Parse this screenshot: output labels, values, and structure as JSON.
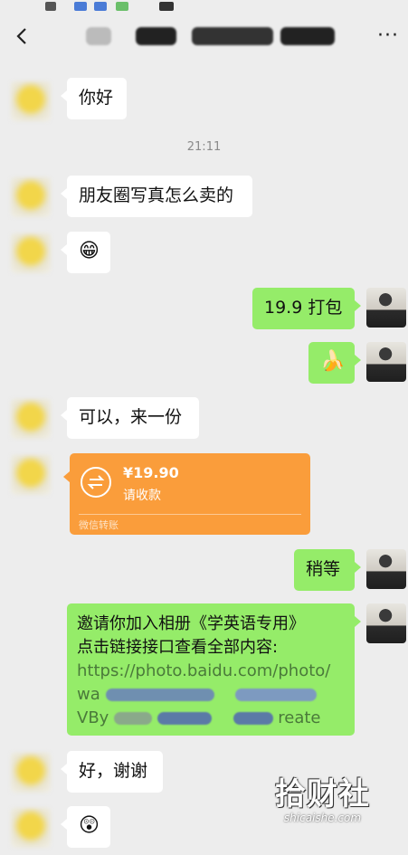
{
  "navbar": {
    "more_label": "···"
  },
  "timestamp": "21:11",
  "messages": {
    "m1": "你好",
    "m2": "朋友圈写真怎么卖的",
    "m3_emoji": "😁",
    "m4": "19.9 打包",
    "m5_emoji": "🍌",
    "m6": "可以，来一份",
    "transfer": {
      "amount": "¥19.90",
      "note": "请收款",
      "footer": "微信转账"
    },
    "m8": "稍等",
    "invite": {
      "line1": "邀请你加入相册《学英语专用》",
      "line2": "点击链接接口查看全部内容:",
      "line3": "https://photo.baidu.com/photo/",
      "line4_prefix": "wa",
      "line5_prefix": "VBy",
      "line5_suffix": "reate"
    },
    "m10": "好，谢谢",
    "m11_emoji": "😲"
  },
  "watermark": {
    "main": "拾财社",
    "sub": "shicaishe.com"
  },
  "colors": {
    "background": "#ededed",
    "incoming": "#ffffff",
    "outgoing": "#95ec69",
    "transfer": "#fa9d3b"
  }
}
